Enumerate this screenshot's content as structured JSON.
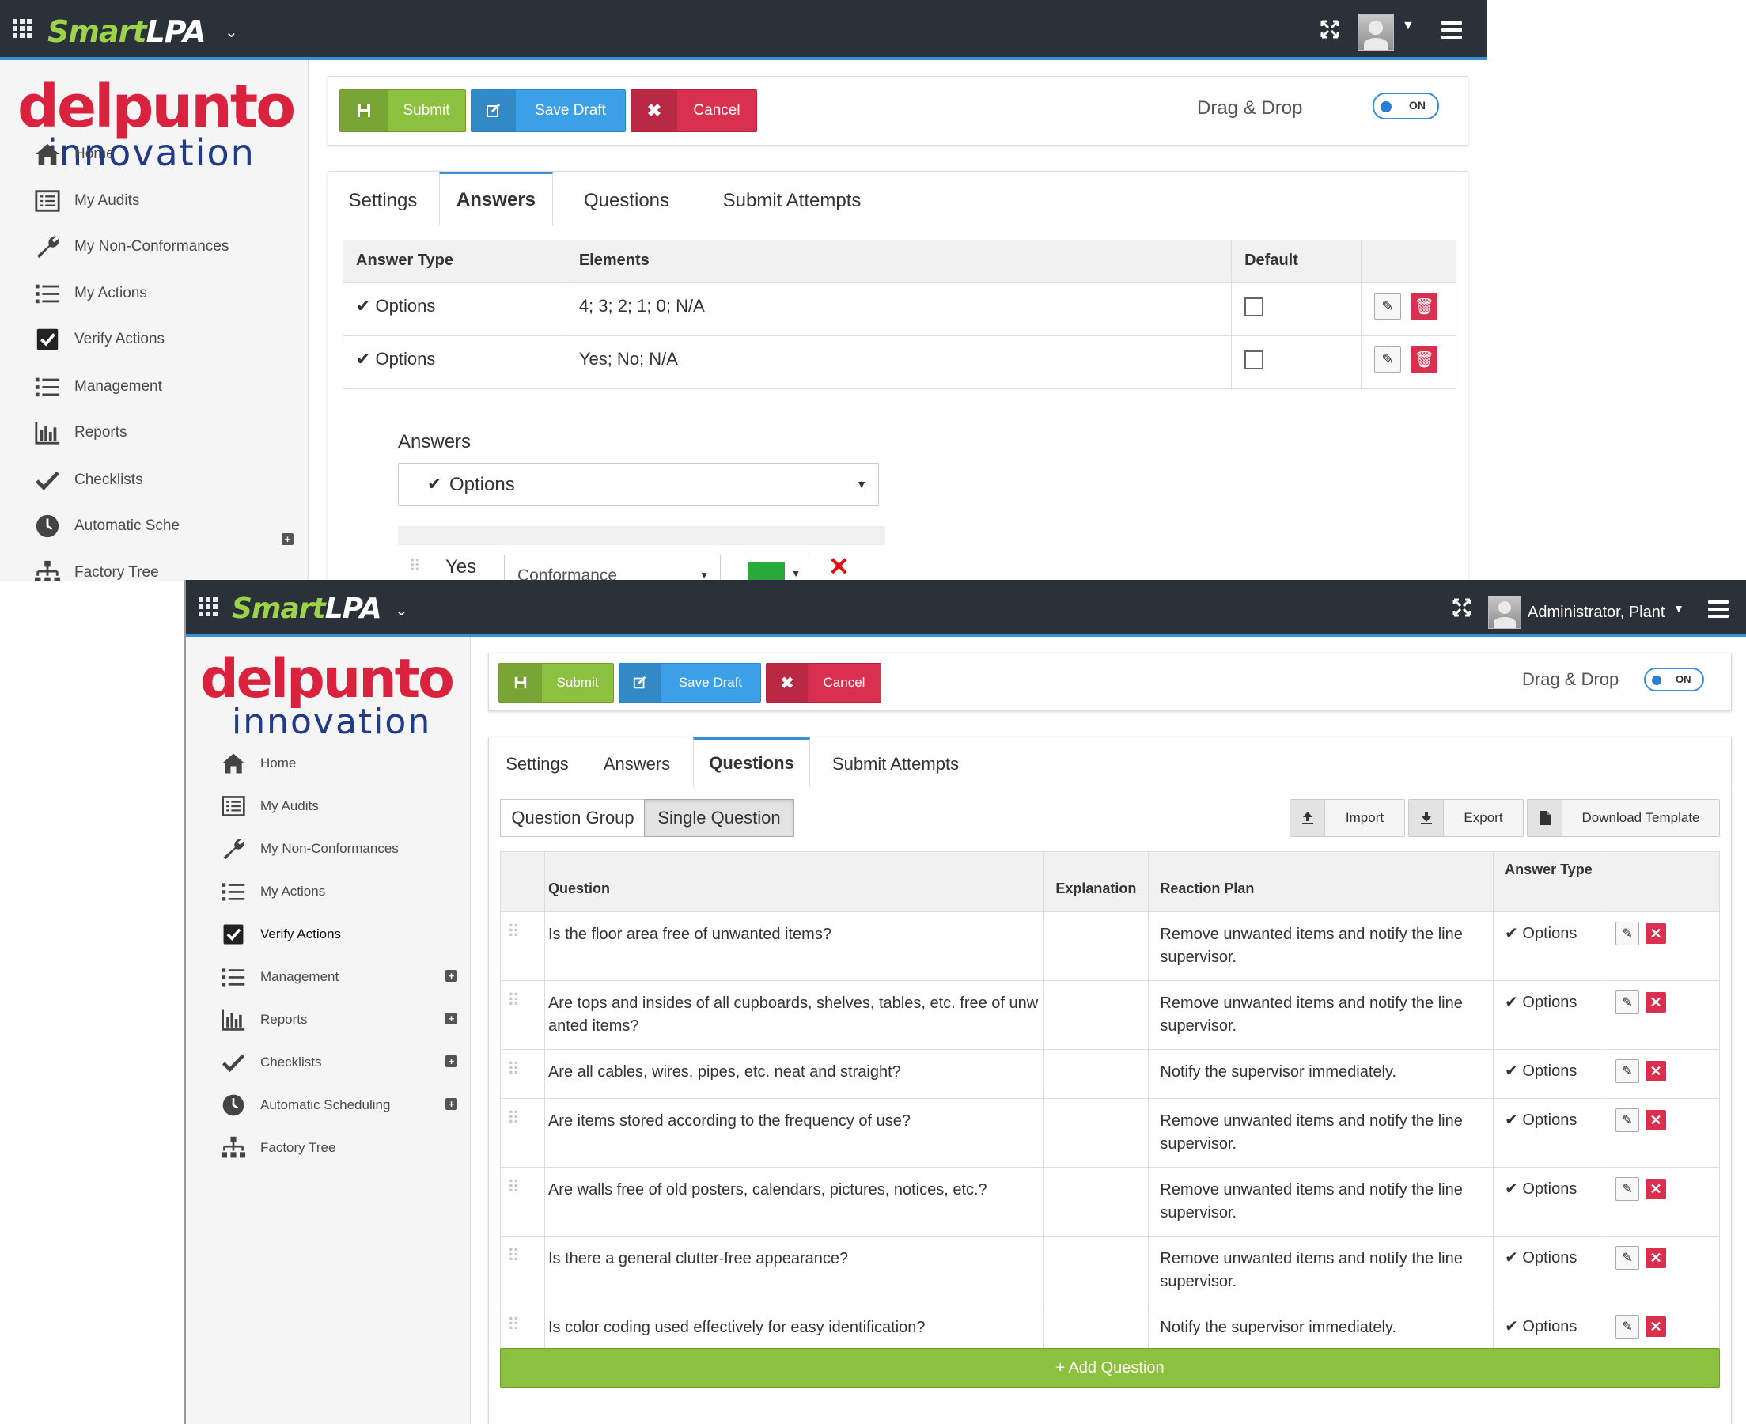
{
  "back_window": {
    "brand": {
      "smart": "Smart",
      "lpa": "LPA"
    },
    "logo": {
      "top": "delpunto",
      "bottom": "innovation"
    },
    "sidebar": [
      {
        "label": "Home",
        "icon": "home-icon"
      },
      {
        "label": "My Audits",
        "icon": "list-icon"
      },
      {
        "label": "My Non-Conformances",
        "icon": "wrench-icon"
      },
      {
        "label": "My Actions",
        "icon": "list-bullets-icon"
      },
      {
        "label": "Verify Actions",
        "icon": "checkbox-icon"
      },
      {
        "label": "Management",
        "icon": "list-bullets-icon"
      },
      {
        "label": "Reports",
        "icon": "bar-chart-icon"
      },
      {
        "label": "Checklists",
        "icon": "check-icon"
      },
      {
        "label": "Automatic Sche",
        "icon": "clock-icon"
      },
      {
        "label": "Factory Tree",
        "icon": "sitemap-icon"
      }
    ],
    "toolbar": {
      "submit": "Submit",
      "save_draft": "Save Draft",
      "cancel": "Cancel",
      "drag_drop": "Drag & Drop",
      "toggle": "ON"
    },
    "tabs": [
      "Settings",
      "Answers",
      "Questions",
      "Submit Attempts"
    ],
    "table": {
      "headers": [
        "Answer Type",
        "Elements",
        "Default"
      ],
      "rows": [
        {
          "type": "Options",
          "elements": "4; 3; 2; 1; 0; N/A"
        },
        {
          "type": "Options",
          "elements": "Yes; No; N/A"
        }
      ]
    },
    "answers_label": "Answers",
    "answers_select": "Options",
    "answer_row": {
      "value": "Yes",
      "category": "Conformance",
      "color": "#2aaa3a"
    }
  },
  "front_window": {
    "brand": {
      "smart": "Smart",
      "lpa": "LPA"
    },
    "user": "Administrator, Plant",
    "logo": {
      "top": "delpunto",
      "bottom": "innovation"
    },
    "sidebar": [
      {
        "label": "Home",
        "icon": "home-icon",
        "plus": false
      },
      {
        "label": "My Audits",
        "icon": "list-icon",
        "plus": false
      },
      {
        "label": "My Non-Conformances",
        "icon": "wrench-icon",
        "plus": false
      },
      {
        "label": "My Actions",
        "icon": "list-bullets-icon",
        "plus": false
      },
      {
        "label": "Verify Actions",
        "icon": "checkbox-icon",
        "plus": false
      },
      {
        "label": "Management",
        "icon": "list-bullets-icon",
        "plus": true
      },
      {
        "label": "Reports",
        "icon": "bar-chart-icon",
        "plus": true
      },
      {
        "label": "Checklists",
        "icon": "check-icon",
        "plus": true
      },
      {
        "label": "Automatic Scheduling",
        "icon": "clock-icon",
        "plus": true
      },
      {
        "label": "Factory Tree",
        "icon": "sitemap-icon",
        "plus": false
      }
    ],
    "toolbar": {
      "submit": "Submit",
      "save_draft": "Save Draft",
      "cancel": "Cancel",
      "drag_drop": "Drag & Drop",
      "toggle": "ON"
    },
    "tabs": [
      "Settings",
      "Answers",
      "Questions",
      "Submit Attempts"
    ],
    "subtabs": {
      "group": "Question Group",
      "single": "Single Question"
    },
    "actions": {
      "import": "Import",
      "export": "Export",
      "download": "Download Template"
    },
    "table": {
      "headers": {
        "question": "Question",
        "explanation": "Explanation",
        "reaction_plan": "Reaction Plan",
        "answer_type": "Answer Type"
      },
      "rows": [
        {
          "question": "Is the floor area free of unwanted items?",
          "explanation": "",
          "plan": "Remove unwanted items and notify the line supervisor.",
          "type": "Options"
        },
        {
          "question": "Are tops and insides of all cupboards, shelves, tables, etc. free of unwanted items?",
          "explanation": "",
          "plan": "Remove unwanted items and notify the line supervisor.",
          "type": "Options"
        },
        {
          "question": "Are all cables, wires, pipes, etc. neat and straight?",
          "explanation": "",
          "plan": "Notify the supervisor immediately.",
          "type": "Options"
        },
        {
          "question": "Are items stored according to the frequency of use?",
          "explanation": "",
          "plan": "Remove unwanted items and notify the line supervisor.",
          "type": "Options"
        },
        {
          "question": "Are walls free of old posters, calendars, pictures, notices, etc.?",
          "explanation": "",
          "plan": "Remove unwanted items and notify the line supervisor.",
          "type": "Options"
        },
        {
          "question": "Is there a general clutter-free appearance?",
          "explanation": "",
          "plan": "Remove unwanted items and notify the line supervisor.",
          "type": "Options"
        },
        {
          "question": "Is color coding used effectively for easy identification?",
          "explanation": "",
          "plan": "Notify the supervisor immediately.",
          "type": "Options"
        }
      ]
    },
    "add_question": "+ Add Question"
  },
  "colors": {
    "topbar": "#2a3139",
    "accent": "#3a8fd9",
    "green": "#8cc03f",
    "blue": "#3ba0e6",
    "red": "#d9304f",
    "logo_red": "#d9233e",
    "logo_blue": "#1f3b8a"
  }
}
